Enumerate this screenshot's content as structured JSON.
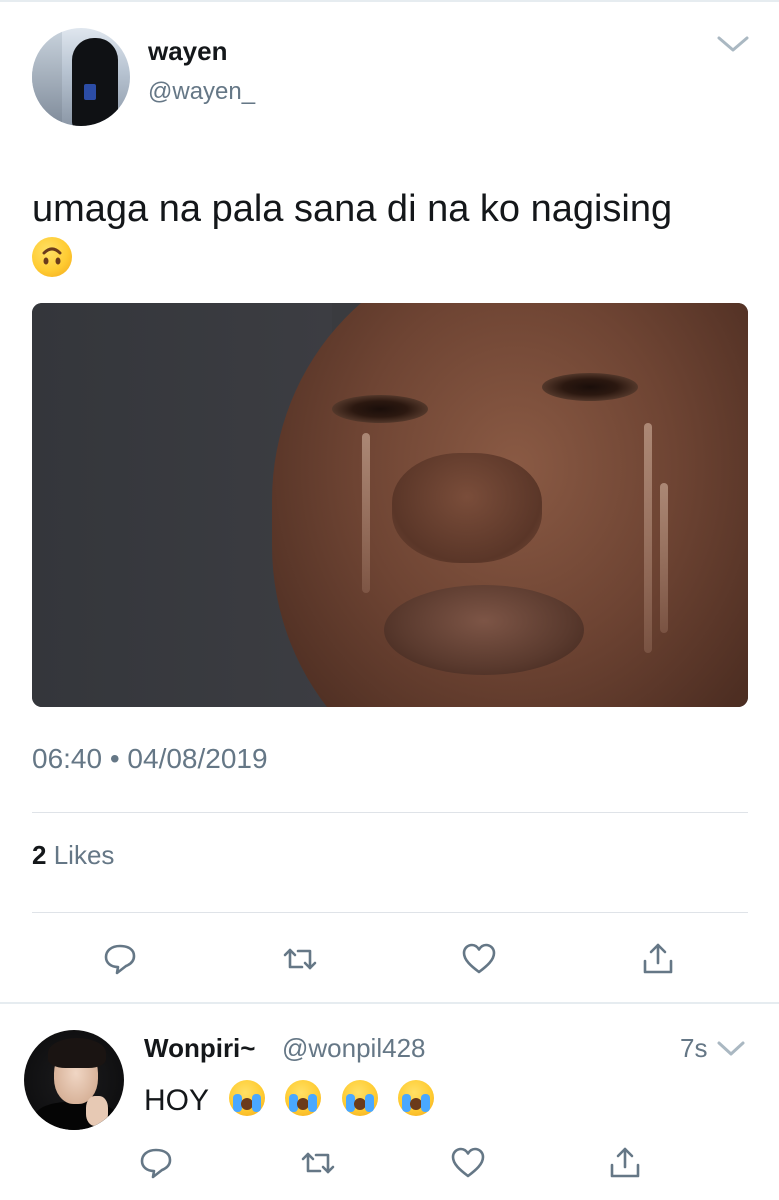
{
  "tweet": {
    "author": {
      "display_name": "wayen",
      "handle": "@wayen_"
    },
    "text": "umaga na pala sana di na ko nagising",
    "emoji": "upside-down-face",
    "timestamp": "06:40 • 04/08/2019",
    "likes": {
      "count": "2",
      "label": "Likes"
    },
    "actions": [
      {
        "name": "reply",
        "icon": "reply-icon"
      },
      {
        "name": "retweet",
        "icon": "retweet-icon"
      },
      {
        "name": "like",
        "icon": "heart-icon"
      },
      {
        "name": "share",
        "icon": "share-icon"
      }
    ]
  },
  "reply": {
    "author": {
      "display_name": "Wonpiri~",
      "handle": "@wonpil428"
    },
    "time": "7s",
    "text": "HOY",
    "emojis": [
      "loudly-crying-face",
      "loudly-crying-face",
      "loudly-crying-face",
      "loudly-crying-face"
    ],
    "actions": [
      {
        "name": "reply",
        "icon": "reply-icon"
      },
      {
        "name": "retweet",
        "icon": "retweet-icon"
      },
      {
        "name": "like",
        "icon": "heart-icon"
      },
      {
        "name": "share",
        "icon": "share-icon"
      }
    ]
  },
  "colors": {
    "text": "#14171a",
    "secondary": "#657786",
    "divider": "#e6ecf0",
    "icon": "#657786"
  }
}
